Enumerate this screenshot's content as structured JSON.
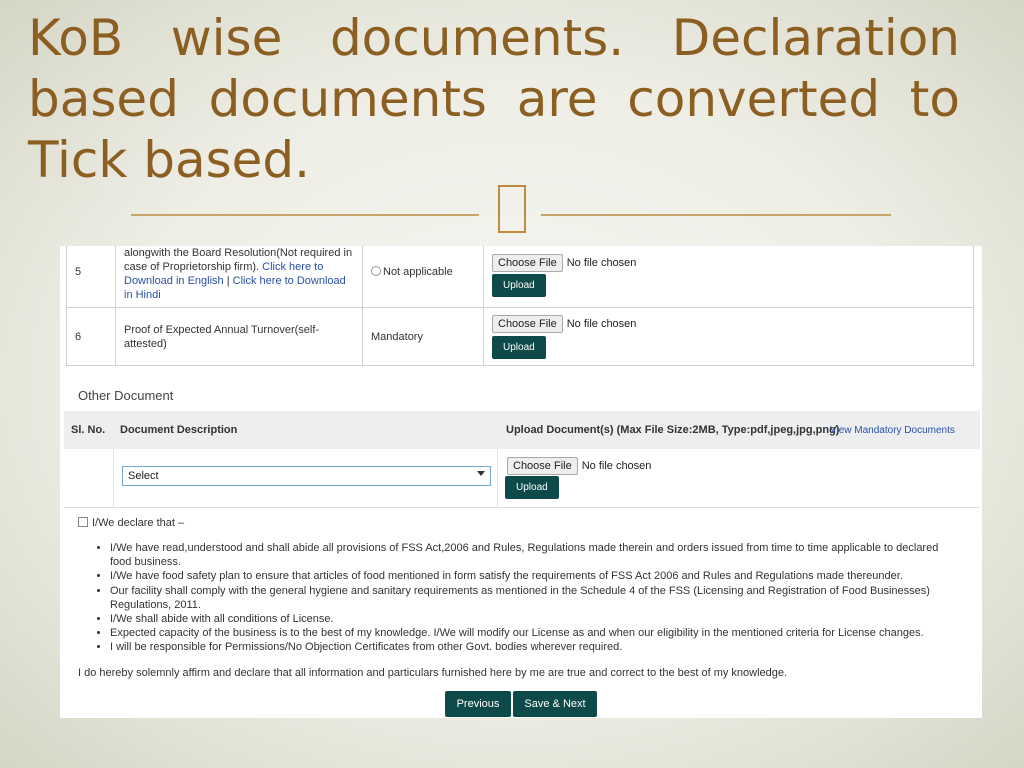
{
  "slide": {
    "title_line1": "KoB wise documents. Declaration",
    "title_line2": "based documents are converted to",
    "title_line3": "Tick based."
  },
  "doc_table": {
    "rows": [
      {
        "sl": "5",
        "desc_partial": "alongwith the Board Resolution(Not required in case of Proprietorship firm).",
        "link1": "Click here to Download in English",
        "link_sep": "|",
        "link2": "Click here to Download in Hindi",
        "requirement": "Not applicable",
        "choose_label": "Choose File",
        "file_status": "No file chosen",
        "upload_label": "Upload"
      },
      {
        "sl": "6",
        "desc": "Proof of Expected Annual Turnover(self-attested)",
        "requirement": "Mandatory",
        "choose_label": "Choose File",
        "file_status": "No file chosen",
        "upload_label": "Upload"
      }
    ]
  },
  "other": {
    "section_title": "Other Document",
    "col_sl": "Sl. No.",
    "col_desc": "Document Description",
    "col_upload": "Upload Document(s) (Max File Size:2MB, Type:pdf,jpeg,jpg,png)",
    "view_link": "View Mandatory Documents",
    "select_value": "Select",
    "choose_label": "Choose File",
    "file_status": "No file chosen",
    "upload_label": "Upload"
  },
  "declaration": {
    "checkbox_label": "I/We declare that –",
    "items": [
      "I/We have read,understood and shall abide all provisions of FSS Act,2006 and Rules, Regulations made therein and orders issued from time to time applicable to declared food business.",
      "I/We have food safety plan to ensure that articles of food mentioned in form satisfy the requirements of FSS Act 2006 and Rules and Regulations made thereunder.",
      "Our facility shall comply with the general hygiene and sanitary requirements as mentioned in the Schedule 4 of the FSS (Licensing and Registration of Food Businesses) Regulations, 2011.",
      "I/We shall abide with all conditions of License.",
      "Expected capacity of the business is to the best of my knowledge. I/We will modify our License as and when our eligibility in the mentioned criteria for License changes.",
      "I will be responsible for Permissions/No Objection Certificates from other Govt. bodies wherever required."
    ],
    "affirmation": "I do hereby solemnly affirm and declare that all information and particulars furnished here by me are true and correct to the best of my knowledge."
  },
  "nav": {
    "previous_label": "Previous",
    "save_next_label": "Save & Next"
  }
}
